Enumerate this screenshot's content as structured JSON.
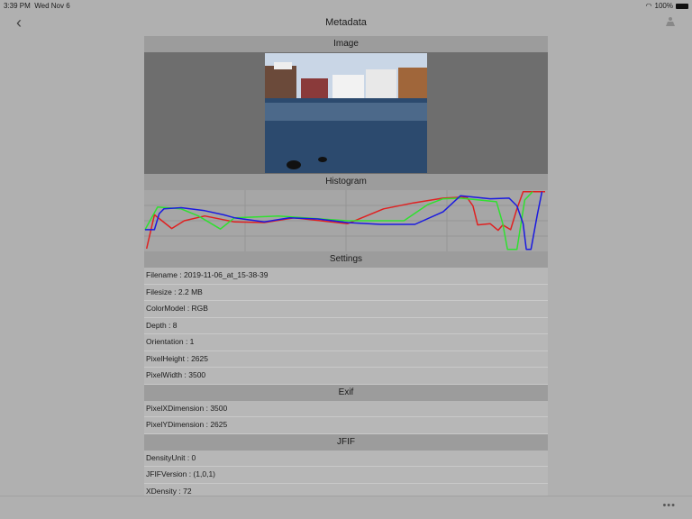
{
  "status": {
    "time": "3:39 PM",
    "date": "Wed Nov 6",
    "battery": "100%"
  },
  "nav": {
    "title": "Metadata",
    "back_icon": "chevron-left",
    "share_icon": "share-icon"
  },
  "sections": {
    "image": "Image",
    "histogram": "Histogram",
    "settings": "Settings",
    "exif": "Exif",
    "jfif": "JFIF"
  },
  "settings": [
    "Filename : 2019-11-06_at_15-38-39",
    "Filesize : 2.2 MB",
    "ColorModel : RGB",
    "Depth : 8",
    "Orientation : 1",
    "PixelHeight : 2625",
    "PixelWidth : 3500"
  ],
  "exif": [
    "PixelXDimension : 3500",
    "PixelYDimension : 2625"
  ],
  "jfif": [
    "DensityUnit : 0",
    "JFIFVersion : (1,0,1)",
    "XDensity : 72"
  ],
  "toolbar": {
    "more": "•••"
  },
  "chart_data": {
    "type": "line",
    "title": "Histogram",
    "xlim": [
      0,
      255
    ],
    "ylim": [
      0,
      1
    ],
    "grid": true,
    "series": [
      {
        "name": "red",
        "color": "#e02020",
        "points": [
          [
            1,
            0.03
          ],
          [
            6,
            0.6
          ],
          [
            17,
            0.37
          ],
          [
            25,
            0.5
          ],
          [
            38,
            0.58
          ],
          [
            57,
            0.48
          ],
          [
            76,
            0.47
          ],
          [
            95,
            0.55
          ],
          [
            129,
            0.45
          ],
          [
            152,
            0.7
          ],
          [
            171,
            0.8
          ],
          [
            190,
            0.88
          ],
          [
            205,
            0.9
          ],
          [
            209,
            0.75
          ],
          [
            212,
            0.43
          ],
          [
            220,
            0.45
          ],
          [
            225,
            0.34
          ],
          [
            228,
            0.43
          ],
          [
            233,
            0.35
          ],
          [
            237,
            0.7
          ],
          [
            241,
            0.99
          ],
          [
            255,
            0.99
          ]
        ]
      },
      {
        "name": "green",
        "color": "#30e030",
        "points": [
          [
            0,
            0.35
          ],
          [
            8,
            0.73
          ],
          [
            23,
            0.7
          ],
          [
            34,
            0.58
          ],
          [
            48,
            0.36
          ],
          [
            57,
            0.55
          ],
          [
            85,
            0.58
          ],
          [
            129,
            0.5
          ],
          [
            165,
            0.5
          ],
          [
            180,
            0.77
          ],
          [
            190,
            0.87
          ],
          [
            201,
            0.88
          ],
          [
            224,
            0.82
          ],
          [
            228,
            0.45
          ],
          [
            231,
            0.02
          ],
          [
            237,
            0.02
          ],
          [
            242,
            0.85
          ],
          [
            247,
            0.99
          ]
        ]
      },
      {
        "name": "blue",
        "color": "#1a1ae0",
        "points": [
          [
            0,
            0.35
          ],
          [
            6,
            0.35
          ],
          [
            9,
            0.62
          ],
          [
            12,
            0.7
          ],
          [
            23,
            0.72
          ],
          [
            38,
            0.67
          ],
          [
            50,
            0.6
          ],
          [
            57,
            0.55
          ],
          [
            76,
            0.48
          ],
          [
            92,
            0.55
          ],
          [
            110,
            0.53
          ],
          [
            129,
            0.47
          ],
          [
            150,
            0.44
          ],
          [
            172,
            0.44
          ],
          [
            190,
            0.65
          ],
          [
            201,
            0.92
          ],
          [
            220,
            0.87
          ],
          [
            232,
            0.88
          ],
          [
            237,
            0.75
          ],
          [
            241,
            0.45
          ],
          [
            243,
            0.02
          ],
          [
            246,
            0.02
          ],
          [
            250,
            0.6
          ],
          [
            253,
            0.99
          ]
        ]
      }
    ]
  }
}
